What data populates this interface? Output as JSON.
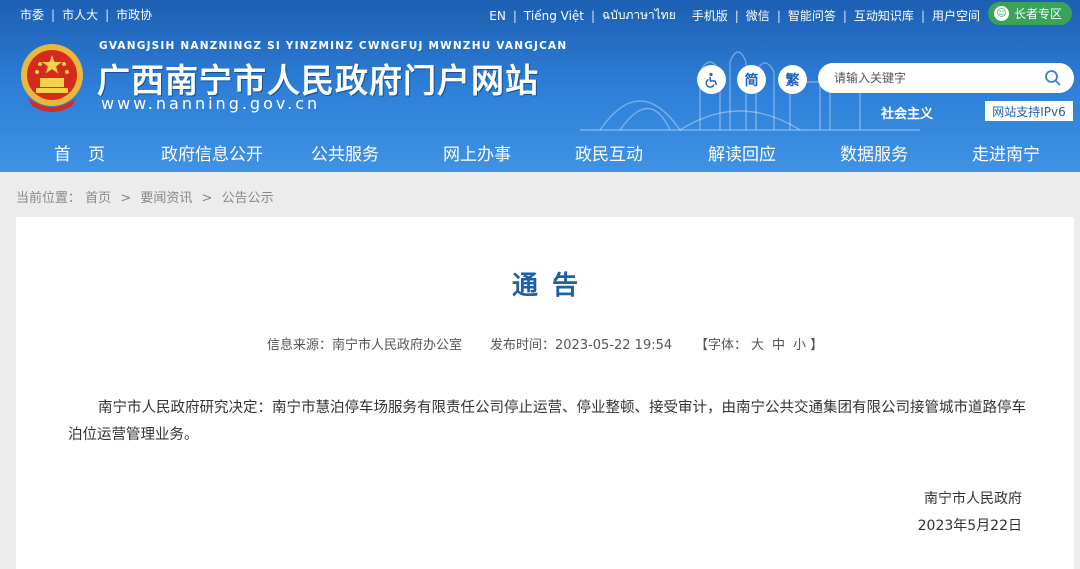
{
  "topbar": {
    "left_links": [
      "市委",
      "市人大",
      "市政协"
    ],
    "languages": [
      "EN",
      "Tiếng Việt",
      "ฉบับภาษาไทย"
    ],
    "right_links": [
      "手机版",
      "微信",
      "智能问答",
      "互动知识库",
      "用户空间"
    ],
    "elder_mode": "长者专区"
  },
  "header": {
    "pinyin": "GVANGJSIH NANZNINGZ SI YINZMINZ CWNGFUJ MWNZHU VANGJCAN",
    "site_name": "广西南宁市人民政府门户网站",
    "domain": "www.nanning.gov.cn",
    "accessibility_icon": "wheelchair-icon",
    "simplified": "简",
    "traditional": "繁",
    "search_placeholder": "请输入关键字",
    "search_icon": "search-icon",
    "slogan": "社会主义",
    "ipv6": "网站支持IPv6"
  },
  "nav": [
    "首　页",
    "政府信息公开",
    "公共服务",
    "网上办事",
    "政民互动",
    "解读回应",
    "数据服务",
    "走进南宁"
  ],
  "breadcrumb": {
    "prefix": "当前位置：",
    "items": [
      "首页",
      "要闻资讯",
      "公告公示"
    ]
  },
  "article": {
    "title": "通告",
    "source_label": "信息来源：南宁市人民政府办公室",
    "date_label": "发布时间：2023-05-22 19:54",
    "font_size_open": "【字体：",
    "font_sizes": [
      "大",
      "中",
      "小"
    ],
    "font_size_close": "】",
    "paragraph": "南宁市人民政府研究决定：南宁市慧泊停车场服务有限责任公司停止运营、停业整顿、接受审计，由南宁公共交通集团有限公司接管城市道路停车泊位运营管理业务。",
    "signature": "南宁市人民政府",
    "sign_date": "2023年5月22日"
  },
  "colors": {
    "header_blue": "#2e7fd8",
    "title_blue": "#1e5fa8",
    "elder_green": "#3aa35a",
    "page_bg": "#ececec"
  }
}
